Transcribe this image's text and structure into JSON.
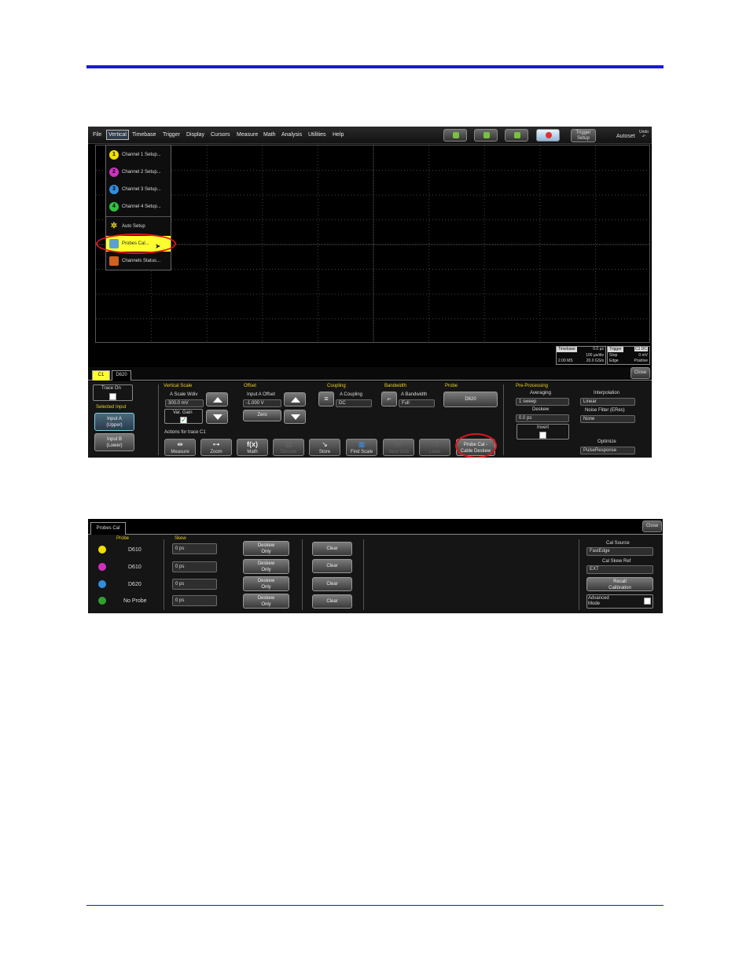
{
  "scope": {
    "menu": [
      "File",
      "Vertical",
      "Timebase",
      "Trigger",
      "Display",
      "Cursors",
      "Measure",
      "Math",
      "Analysis",
      "Utilities",
      "Help"
    ],
    "trigger_setup": "Trigger\nSetup",
    "autoset": "Autoset",
    "undo": "Undo",
    "dropdown": [
      {
        "num": "1",
        "label": "Channel 1 Setup...",
        "color": "#f0e000"
      },
      {
        "num": "2",
        "label": "Channel 2 Setup...",
        "color": "#d030c0"
      },
      {
        "num": "3",
        "label": "Channel 3 Setup...",
        "color": "#2f8ee0"
      },
      {
        "num": "4",
        "label": "Channel 4 Setup...",
        "color": "#30c040"
      },
      {
        "num": "",
        "label": "Auto Setup",
        "color": ""
      },
      {
        "num": "",
        "label": "Probes Cal...",
        "color": ""
      },
      {
        "num": "",
        "label": "Channels Status...",
        "color": ""
      }
    ],
    "timebase": {
      "hdr": "Timebase",
      "top_value": "0.0 µs",
      "per_div": "100 µs/div",
      "samples": "2.00 MS",
      "rate": "20.0 GS/s"
    },
    "trigger": {
      "hdr": "Trigger",
      "mode_icon": "C1 DC",
      "mode": "Stop",
      "level": "0 mV",
      "type": "Edge",
      "slope": "Positive"
    },
    "tabs": {
      "c1": "C1",
      "probe": "D620"
    },
    "close": "Close",
    "panel": {
      "trace_on": "Trace On",
      "selected_input": "Selected Input",
      "input_a": "Input A\n(Upper)",
      "input_b": "Input B\n(Lower)",
      "vertical_scale": "Vertical Scale",
      "a_scale_label": "A Scale Wdiv",
      "a_scale_value": "300.0 mV",
      "var_gain": "Var. Gain",
      "offset": "Offset",
      "input_a_offset_label": "Input A Offset",
      "input_a_offset_value": "-1.000 V",
      "zero": "Zero",
      "coupling": "Coupling",
      "a_coupling_label": "A Coupling",
      "a_coupling_value": "DC",
      "bandwidth": "Bandwidth",
      "a_bandwidth_label": "A Bandwidth",
      "a_bandwidth_value": "Full",
      "probe": "Probe",
      "probe_value": "D620",
      "actions_for": "Actions for trace C1",
      "actions": [
        "Measure",
        "Zoom",
        "Math",
        "Decode",
        "Store",
        "Find Scale",
        "Next Grid",
        "Label"
      ],
      "probe_cal": "Probe Cal -\nCable Deskew",
      "pre_processing": "Pre-Processing",
      "averaging": "Averaging",
      "averaging_value": "1 sweep",
      "deskew": "Deskew",
      "deskew_value": "0.0 ps",
      "invert": "Invert",
      "interpolation": "Interpolation",
      "interpolation_value": "Linear",
      "noise_filter": "Noise Filter (ERes)",
      "noise_filter_value": "None",
      "optimize": "Optimize",
      "optimize_value": "PulseResponse"
    }
  },
  "cal": {
    "tab": "Probes Cal",
    "close": "Close",
    "probe_header": "Probe",
    "skew_header": "Skew",
    "rows": [
      {
        "probe": "D610",
        "skew": "0 ps",
        "deskew": "Deskew\nOnly",
        "clear": "Clear",
        "color": "#f0e000"
      },
      {
        "probe": "D610",
        "skew": "0 ps",
        "deskew": "Deskew\nOnly",
        "clear": "Clear",
        "color": "#d030c0"
      },
      {
        "probe": "D620",
        "skew": "0 ps",
        "deskew": "Deskew\nOnly",
        "clear": "Clear",
        "color": "#2f8ee0"
      },
      {
        "probe": "No Probe",
        "skew": "0 ps",
        "deskew": "Deskew\nOnly",
        "clear": "Clear",
        "color": "#30a030"
      }
    ],
    "cal_source": "Cal Source",
    "cal_source_value": "FastEdge",
    "cal_skew_ref": "Cal Skew Ref",
    "cal_skew_ref_value": "EXT",
    "recall": "Recall\nCalibration",
    "advanced": "Advanced\nMode"
  }
}
